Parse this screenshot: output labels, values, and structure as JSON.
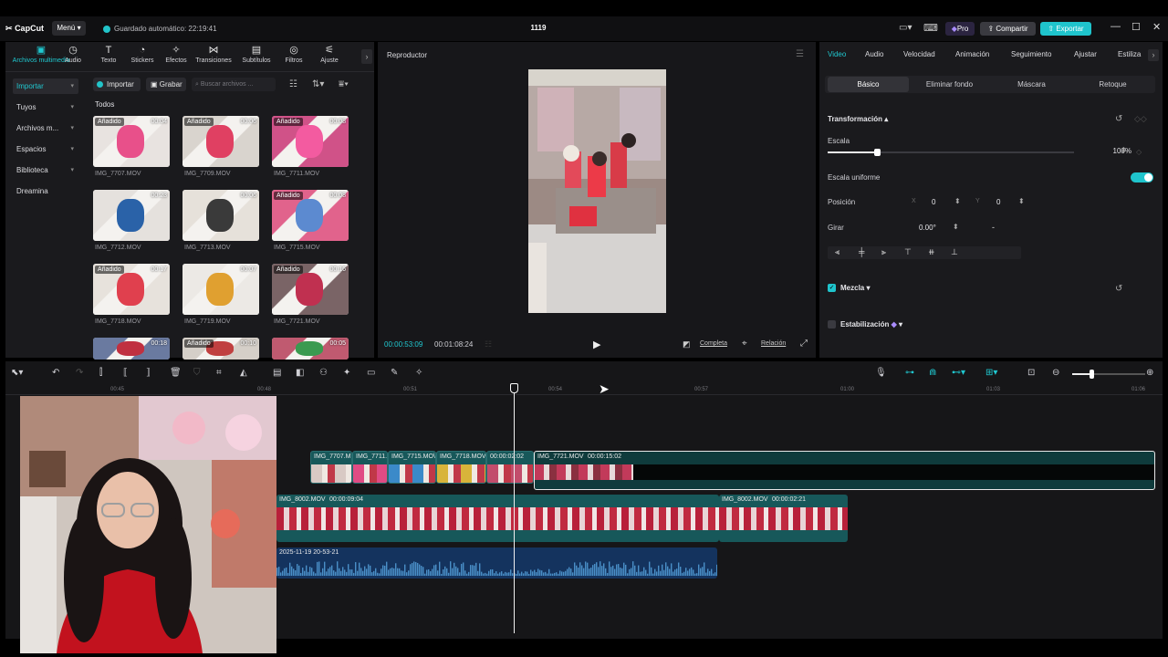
{
  "app": {
    "logo": "CapCut",
    "menu": "Menú",
    "autosave": "Guardado automático: 22:19:41",
    "project_name": "1119"
  },
  "topbar": {
    "pro": "Pro",
    "share": "Compartir",
    "export": "Exportar"
  },
  "media_tabs": [
    {
      "label": "Archivos multimedia",
      "icon": "media-icon"
    },
    {
      "label": "Audio",
      "icon": "audio-icon"
    },
    {
      "label": "Texto",
      "icon": "text-icon"
    },
    {
      "label": "Stickers",
      "icon": "sticker-icon"
    },
    {
      "label": "Efectos",
      "icon": "effects-icon"
    },
    {
      "label": "Transiciones",
      "icon": "transitions-icon"
    },
    {
      "label": "Subtítulos",
      "icon": "subtitles-icon"
    },
    {
      "label": "Filtros",
      "icon": "filters-icon"
    },
    {
      "label": "Ajuste",
      "icon": "adjust-icon"
    }
  ],
  "sidebar": [
    "Importar",
    "Tuyos",
    "Archivos m...",
    "Espacios",
    "Biblioteca",
    "Dreamina"
  ],
  "media_toolbar": {
    "import": "Importar",
    "record": "Grabar",
    "search_placeholder": "Buscar archivos ..."
  },
  "media_section": "Todos",
  "media_items": [
    {
      "name": "IMG_7707.MOV",
      "duration": "00:04",
      "added": "Añadido"
    },
    {
      "name": "IMG_7709.MOV",
      "duration": "00:06",
      "added": "Añadido"
    },
    {
      "name": "IMG_7711.MOV",
      "duration": "00:08",
      "added": "Añadido"
    },
    {
      "name": "IMG_7712.MOV",
      "duration": "00:23",
      "added": ""
    },
    {
      "name": "IMG_7713.MOV",
      "duration": "00:06",
      "added": ""
    },
    {
      "name": "IMG_7715.MOV",
      "duration": "00:08",
      "added": "Añadido"
    },
    {
      "name": "IMG_7718.MOV",
      "duration": "00:17",
      "added": "Añadido"
    },
    {
      "name": "IMG_7719.MOV",
      "duration": "00:07",
      "added": ""
    },
    {
      "name": "IMG_7721.MOV",
      "duration": "00:16",
      "added": "Añadido"
    },
    {
      "name": "",
      "duration": "00:18",
      "added": ""
    },
    {
      "name": "",
      "duration": "00:10",
      "added": "Añadido"
    },
    {
      "name": "",
      "duration": "00:05",
      "added": ""
    }
  ],
  "player": {
    "title": "Reproductor",
    "current_time": "00:00:53:09",
    "total_time": "00:01:08:24",
    "full": "Completa",
    "ratio": "Relación"
  },
  "inspector": {
    "tabs": [
      "Video",
      "Audio",
      "Velocidad",
      "Animación",
      "Seguimiento",
      "Ajustar",
      "Estiliza"
    ],
    "subtabs": [
      "Básico",
      "Eliminar fondo",
      "Máscara",
      "Retoque"
    ],
    "transform": "Transformación",
    "scale": "Escala",
    "scale_value": "100%",
    "scale_fraction": 0.2,
    "uniform_scale": "Escala uniforme",
    "position": "Posición",
    "pos_x_label": "X",
    "pos_x": "0",
    "pos_y_label": "Y",
    "pos_y": "0",
    "rotate": "Girar",
    "rotate_value": "0.00°",
    "rotate_dash": "-",
    "blend": "Mezcla",
    "stabilize": "Estabilización"
  },
  "timeline": {
    "ruler": [
      "00:45",
      "00:48",
      "00:51",
      "00:54",
      "00:57",
      "01:00",
      "01:03",
      "01:06"
    ],
    "main_clips": [
      "IMG_7707.M",
      "IMG_7711.A",
      "IMG_7715.MO\\",
      "IMG_7718.MOV",
      "00:00:02:02"
    ],
    "selected_clip": {
      "name": "IMG_7721.MOV",
      "duration": "00:00:15:02"
    },
    "overlay_clips": [
      {
        "name": "IMG_8002.MOV",
        "duration": "00:00:09:04"
      },
      {
        "name": "IMG_8002.MOV",
        "duration": "00:00:02:21"
      }
    ],
    "audio_clip": "2025-11-19 20-53-21"
  }
}
